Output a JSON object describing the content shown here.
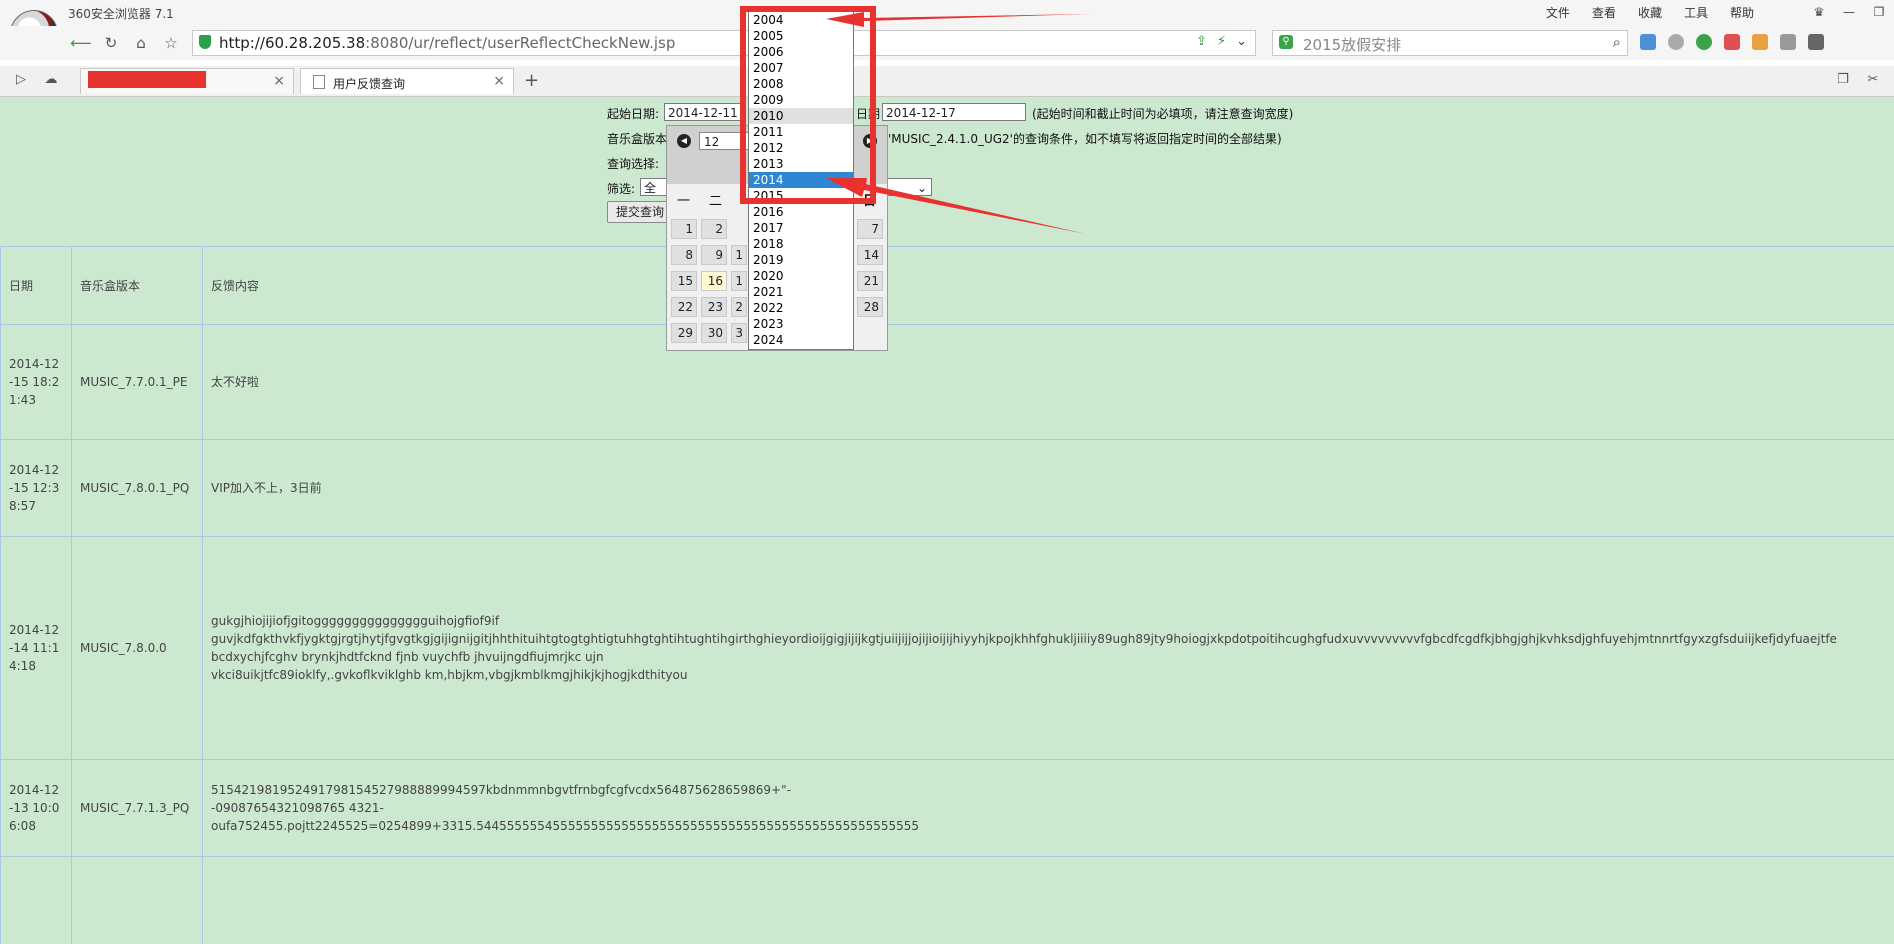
{
  "browser": {
    "app_title": "360安全浏览器 7.1",
    "menus": [
      "文件",
      "查看",
      "收藏",
      "工具",
      "帮助"
    ],
    "window_controls": [
      "shirt-icon",
      "minimize-icon",
      "maximize-icon"
    ],
    "url_host": "http://60.28.205.38",
    "url_rest": ":8080/ur/reflect/userReflectCheckNew.jsp",
    "search_text": "2015放假安排",
    "tabs": [
      {
        "label": "",
        "active": false
      },
      {
        "label": "用户反馈查询",
        "active": true
      }
    ],
    "newtab_label": "+",
    "accent_red": "#e8322f"
  },
  "form": {
    "start_label": "起始日期:",
    "start_value": "2014-12-11",
    "end_label": "日期",
    "end_value": "2014-12-17",
    "date_note": "(起始时间和截止时间为必填项，请注意查询宽度)",
    "version_label": "音乐盒版本",
    "version_note": "'MUSIC_2.4.1.0_UG2'的查询条件，如不填写将返回指定时间的全部结果)",
    "query_label": "查询选择:",
    "filter_label": "筛选:",
    "filter_value": "全部",
    "submit_label": "提交查询"
  },
  "calendar": {
    "month": "12",
    "weekdays": [
      "一",
      "二",
      "日"
    ],
    "rows": [
      [
        "1",
        "2",
        "7"
      ],
      [
        "8",
        "9",
        "1",
        "14"
      ],
      [
        "15",
        "16",
        "1",
        "21"
      ],
      [
        "22",
        "23",
        "2",
        "28"
      ],
      [
        "29",
        "30",
        "3"
      ]
    ],
    "today": "16"
  },
  "years": {
    "options": [
      "2004",
      "2005",
      "2006",
      "2007",
      "2008",
      "2009",
      "2010",
      "2011",
      "2012",
      "2013",
      "2014",
      "2015",
      "2016",
      "2017",
      "2018",
      "2019",
      "2020",
      "2021",
      "2022",
      "2023",
      "2024"
    ],
    "hovered": "2010",
    "selected": "2014"
  },
  "table": {
    "headers": [
      "日期",
      "音乐盒版本",
      "反馈内容"
    ],
    "rows": [
      {
        "date": "2014-12-15 18:21:43",
        "version": "MUSIC_7.7.0.1_PE",
        "content": "太不好啦"
      },
      {
        "date": "2014-12-15 12:38:57",
        "version": "MUSIC_7.8.0.1_PQ",
        "content": "VIP加入不上，3日前"
      },
      {
        "date": "2014-12-14 11:14:18",
        "version": "MUSIC_7.8.0.0",
        "content": "gukgjhiojijiofjgitoggggggggggggggguihojgfiof9if\nguvjkdfgkthvkfjygktgjrgtjhytjfgvgtkgjgijignijgitjhhthituihtgtogtghtigtuhhgtghtihtughtihgirthghieyordioijgigjijijkgtjuiijijjojijioijijhiyyhjkpojkhhfghukljiiiiy89ugh89jty9hoiogjxkpdotpoitihcughgfudxuvvvvvvvvvfgbcdfcgdfkjbhgjghjkvhksdjghfuyehjmtnnrtfgyxzgfsduiijkefjdyfuaejtfe\nbcdxychjfcghv brynkjhdtfcknd fjnb vuychfb jhvuijngdfiujmrjkc ujn\nvkci8uikjtfc89ioklfy,.gvkoflkviklghb km,hbjkm,vbgjkmblkmgjhikjkjhogjkdthityou"
      },
      {
        "date": "2014-12-13 10:06:08",
        "version": "MUSIC_7.7.1.3_PQ",
        "content": "515421981952491798154527988889994597kbdnmmnbgvtfrnbgfcgfvcdx564875628659869+\"-\n-09087654321098765 4321-\noufa752455.pojtt2245525=0254899+3315.5445555554555555555555555555555555555555555555555555555555"
      },
      {
        "date": "",
        "version": "",
        "content": ""
      }
    ]
  }
}
